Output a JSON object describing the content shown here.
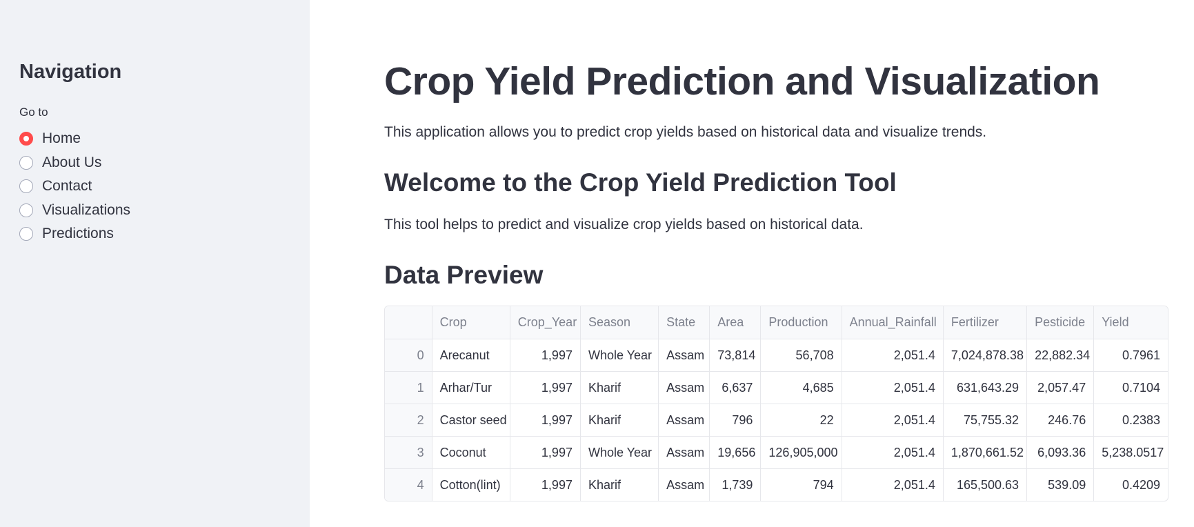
{
  "sidebar": {
    "title": "Navigation",
    "radio_label": "Go to",
    "options": [
      {
        "label": "Home",
        "selected": true
      },
      {
        "label": "About Us",
        "selected": false
      },
      {
        "label": "Contact",
        "selected": false
      },
      {
        "label": "Visualizations",
        "selected": false
      },
      {
        "label": "Predictions",
        "selected": false
      }
    ]
  },
  "main": {
    "title": "Crop Yield Prediction and Visualization",
    "intro": "This application allows you to predict crop yields based on historical data and visualize trends.",
    "welcome_heading": "Welcome to the Crop Yield Prediction Tool",
    "tool_description": "This tool helps to predict and visualize crop yields based on historical data.",
    "preview_heading": "Data Preview"
  },
  "table": {
    "columns": [
      "",
      "Crop",
      "Crop_Year",
      "Season",
      "State",
      "Area",
      "Production",
      "Annual_Rainfall",
      "Fertilizer",
      "Pesticide",
      "Yield"
    ],
    "rows": [
      [
        "0",
        "Arecanut",
        "1,997",
        "Whole Year",
        "Assam",
        "73,814",
        "56,708",
        "2,051.4",
        "7,024,878.38",
        "22,882.34",
        "0.7961"
      ],
      [
        "1",
        "Arhar/Tur",
        "1,997",
        "Kharif",
        "Assam",
        "6,637",
        "4,685",
        "2,051.4",
        "631,643.29",
        "2,057.47",
        "0.7104"
      ],
      [
        "2",
        "Castor seed",
        "1,997",
        "Kharif",
        "Assam",
        "796",
        "22",
        "2,051.4",
        "75,755.32",
        "246.76",
        "0.2383"
      ],
      [
        "3",
        "Coconut",
        "1,997",
        "Whole Year",
        "Assam",
        "19,656",
        "126,905,000",
        "2,051.4",
        "1,870,661.52",
        "6,093.36",
        "5,238.0517"
      ],
      [
        "4",
        "Cotton(lint)",
        "1,997",
        "Kharif",
        "Assam",
        "1,739",
        "794",
        "2,051.4",
        "165,500.63",
        "539.09",
        "0.4209"
      ]
    ]
  },
  "colors": {
    "accent": "#ff4b4b",
    "sidebar_bg": "#f0f2f6",
    "text": "#31333f",
    "muted": "#7d818d"
  }
}
